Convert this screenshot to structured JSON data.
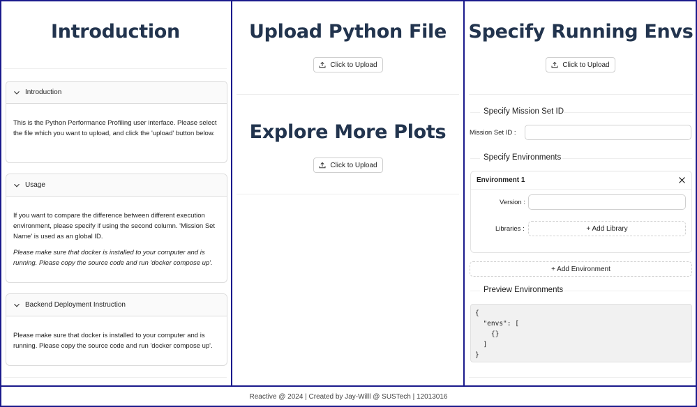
{
  "intro": {
    "title": "Introduction",
    "panels": [
      {
        "header": "Introduction",
        "paragraphs": [
          "This is the Python Performance Profiling user interface. Please select the file which you want to upload, and click the 'upload' button below."
        ]
      },
      {
        "header": "Usage",
        "paragraphs": [
          "If you want to compare the difference between different execution environment, please specify if using the second column. 'Mission Set Name' is used as an global ID.",
          "Please make sure that docker is installed to your computer and is running. Please copy the source code and run 'docker compose up'."
        ]
      },
      {
        "header": "Backend Deployment Instruction",
        "paragraphs": [
          "Please make sure that docker is installed to your computer and is running. Please copy the source code and run 'docker compose up'."
        ]
      }
    ]
  },
  "upload": {
    "title": "Upload Python File",
    "button": "Click to Upload"
  },
  "explore": {
    "title": "Explore More Plots",
    "button": "Click to Upload"
  },
  "envs": {
    "title": "Specify Running Envs",
    "button": "Click to Upload",
    "mission_section": "Specify Mission Set ID",
    "mission_label": "Mission Set ID",
    "mission_value": "",
    "environments_section": "Specify Environments",
    "env_card_title": "Environment 1",
    "version_label": "Version",
    "version_value": "",
    "libraries_label": "Libraries",
    "add_library": "+ Add Library",
    "add_environment": "+ Add Environment",
    "preview_section": "Preview Environments",
    "preview_code": "{\n  \"envs\": [\n    {}\n  ]\n}"
  },
  "footer": {
    "text": "Reactive @ 2024 | Created by Jay-Willl @ SUSTech | 12013016"
  },
  "icons": {
    "upload": "upload-icon",
    "chevron": "chevron-down-icon",
    "close": "close-icon"
  },
  "colors": {
    "border_accent": "#1a1a8c",
    "title": "#22344e"
  }
}
